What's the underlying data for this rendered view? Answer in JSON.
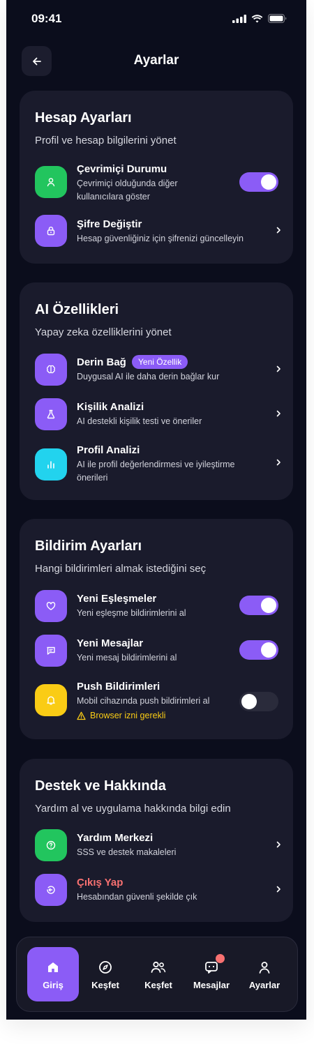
{
  "status_bar": {
    "time": "09:41"
  },
  "header": {
    "title": "Ayarlar"
  },
  "colors": {
    "accent": "#8b5cf6",
    "green": "#22c55e",
    "cyan": "#22d3ee",
    "yellow": "#facc15",
    "danger": "#f87171"
  },
  "account": {
    "title": "Hesap Ayarları",
    "subtitle": "Profil ve hesap bilgilerini yönet",
    "online": {
      "label": "Çevrimiçi Durumu",
      "desc": "Çevrimiçi olduğunda diğer kullanıcılara göster",
      "enabled": true,
      "icon": "user-icon"
    },
    "password": {
      "label": "Şifre Değiştir",
      "desc": "Hesap güvenliğiniz için şifrenizi güncelleyin",
      "icon": "lock-icon"
    }
  },
  "ai": {
    "title": "AI Özellikleri",
    "subtitle": "Yapay zeka özelliklerini yönet",
    "deep_bond": {
      "label": "Derin Bağ",
      "badge": "Yeni Özellik",
      "desc": "Duygusal AI ile daha derin bağlar kur",
      "icon": "brain-icon"
    },
    "personality": {
      "label": "Kişilik Analizi",
      "desc": "AI destekli kişilik testi ve öneriler",
      "icon": "flask-icon"
    },
    "profile": {
      "label": "Profil Analizi",
      "desc": "AI ile profil değerlendirmesi ve iyileştirme önerileri",
      "icon": "bar-chart-icon"
    }
  },
  "notifications": {
    "title": "Bildirim Ayarları",
    "subtitle": "Hangi bildirimleri almak istediğini seç",
    "matches": {
      "label": "Yeni Eşleşmeler",
      "desc": "Yeni eşleşme bildirimlerini al",
      "enabled": true,
      "icon": "heart-icon"
    },
    "messages": {
      "label": "Yeni Mesajlar",
      "desc": "Yeni mesaj bildirimlerini al",
      "enabled": true,
      "icon": "message-icon"
    },
    "push": {
      "label": "Push Bildirimleri",
      "desc": "Mobil cihazında push bildirimleri al",
      "warning": "Browser izni gerekli",
      "enabled": false,
      "icon": "bell-icon"
    }
  },
  "support": {
    "title": "Destek ve Hakkında",
    "subtitle": "Yardım al ve uygulama hakkında bilgi edin",
    "help": {
      "label": "Yardım Merkezi",
      "desc": "SSS ve destek makaleleri",
      "icon": "help-circle-icon"
    },
    "logout": {
      "label": "Çıkış Yap",
      "desc": "Hesabından güvenli şekilde çık",
      "icon": "logout-icon"
    }
  },
  "bottom_nav": [
    {
      "label": "Giriş",
      "icon": "home-icon",
      "active": true
    },
    {
      "label": "Keşfet",
      "icon": "compass-icon",
      "active": false
    },
    {
      "label": "Keşfet",
      "icon": "users-icon",
      "active": false
    },
    {
      "label": "Mesajlar",
      "icon": "chat-icon",
      "active": false,
      "has_notification": true
    },
    {
      "label": "Ayarlar",
      "icon": "profile-icon",
      "active": false
    }
  ]
}
